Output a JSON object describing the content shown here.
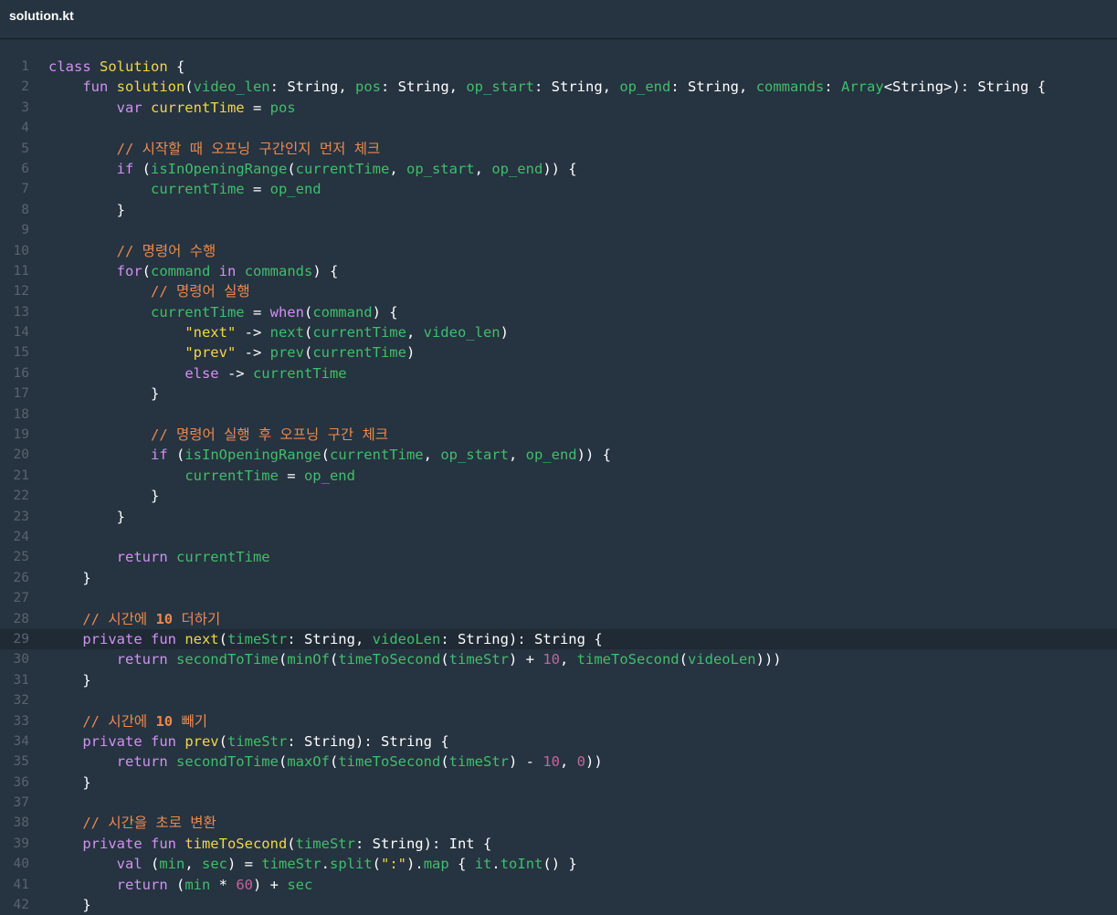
{
  "tab": {
    "filename": "solution.kt"
  },
  "editor": {
    "highlighted_line": 29,
    "lines": [
      [
        [
          "kw",
          "class "
        ],
        [
          "fn",
          "Solution"
        ],
        [
          "p",
          " {"
        ]
      ],
      [
        [
          "p",
          "    "
        ],
        [
          "kw",
          "fun "
        ],
        [
          "fn",
          "solution"
        ],
        [
          "p",
          "("
        ],
        [
          "id",
          "video_len"
        ],
        [
          "p",
          ": "
        ],
        [
          "tp",
          "String"
        ],
        [
          "p",
          ", "
        ],
        [
          "id",
          "pos"
        ],
        [
          "p",
          ": "
        ],
        [
          "tp",
          "String"
        ],
        [
          "p",
          ", "
        ],
        [
          "id",
          "op_start"
        ],
        [
          "p",
          ": "
        ],
        [
          "tp",
          "String"
        ],
        [
          "p",
          ", "
        ],
        [
          "id",
          "op_end"
        ],
        [
          "p",
          ": "
        ],
        [
          "tp",
          "String"
        ],
        [
          "p",
          ", "
        ],
        [
          "id",
          "commands"
        ],
        [
          "p",
          ": "
        ],
        [
          "id",
          "Array"
        ],
        [
          "p",
          "<"
        ],
        [
          "tp",
          "String"
        ],
        [
          "p",
          ">): "
        ],
        [
          "tp",
          "String"
        ],
        [
          "p",
          " {"
        ]
      ],
      [
        [
          "p",
          "        "
        ],
        [
          "kw",
          "var "
        ],
        [
          "fn",
          "currentTime"
        ],
        [
          "p",
          " = "
        ],
        [
          "id",
          "pos"
        ]
      ],
      [],
      [
        [
          "p",
          "        "
        ],
        [
          "cm",
          "// 시작할 때 오프닝 구간인지 먼저 체크"
        ]
      ],
      [
        [
          "p",
          "        "
        ],
        [
          "kw",
          "if "
        ],
        [
          "p",
          "("
        ],
        [
          "id",
          "isInOpeningRange"
        ],
        [
          "p",
          "("
        ],
        [
          "id",
          "currentTime"
        ],
        [
          "p",
          ", "
        ],
        [
          "id",
          "op_start"
        ],
        [
          "p",
          ", "
        ],
        [
          "id",
          "op_end"
        ],
        [
          "p",
          ")) {"
        ]
      ],
      [
        [
          "p",
          "            "
        ],
        [
          "id",
          "currentTime"
        ],
        [
          "p",
          " = "
        ],
        [
          "id",
          "op_end"
        ]
      ],
      [
        [
          "p",
          "        }"
        ]
      ],
      [],
      [
        [
          "p",
          "        "
        ],
        [
          "cm",
          "// 명령어 수행"
        ]
      ],
      [
        [
          "p",
          "        "
        ],
        [
          "kw",
          "for"
        ],
        [
          "p",
          "("
        ],
        [
          "id",
          "command"
        ],
        [
          "p",
          " "
        ],
        [
          "kw",
          "in"
        ],
        [
          "p",
          " "
        ],
        [
          "id",
          "commands"
        ],
        [
          "p",
          ") {"
        ]
      ],
      [
        [
          "p",
          "            "
        ],
        [
          "cm",
          "// 명령어 실행"
        ]
      ],
      [
        [
          "p",
          "            "
        ],
        [
          "id",
          "currentTime"
        ],
        [
          "p",
          " = "
        ],
        [
          "kw",
          "when"
        ],
        [
          "p",
          "("
        ],
        [
          "id",
          "command"
        ],
        [
          "p",
          ") {"
        ]
      ],
      [
        [
          "p",
          "                "
        ],
        [
          "str",
          "\"next\""
        ],
        [
          "p",
          " -> "
        ],
        [
          "id",
          "next"
        ],
        [
          "p",
          "("
        ],
        [
          "id",
          "currentTime"
        ],
        [
          "p",
          ", "
        ],
        [
          "id",
          "video_len"
        ],
        [
          "p",
          ")"
        ]
      ],
      [
        [
          "p",
          "                "
        ],
        [
          "str",
          "\"prev\""
        ],
        [
          "p",
          " -> "
        ],
        [
          "id",
          "prev"
        ],
        [
          "p",
          "("
        ],
        [
          "id",
          "currentTime"
        ],
        [
          "p",
          ")"
        ]
      ],
      [
        [
          "p",
          "                "
        ],
        [
          "kw",
          "else"
        ],
        [
          "p",
          " -> "
        ],
        [
          "id",
          "currentTime"
        ]
      ],
      [
        [
          "p",
          "            }"
        ]
      ],
      [],
      [
        [
          "p",
          "            "
        ],
        [
          "cm",
          "// 명령어 실행 후 오프닝 구간 체크"
        ]
      ],
      [
        [
          "p",
          "            "
        ],
        [
          "kw",
          "if "
        ],
        [
          "p",
          "("
        ],
        [
          "id",
          "isInOpeningRange"
        ],
        [
          "p",
          "("
        ],
        [
          "id",
          "currentTime"
        ],
        [
          "p",
          ", "
        ],
        [
          "id",
          "op_start"
        ],
        [
          "p",
          ", "
        ],
        [
          "id",
          "op_end"
        ],
        [
          "p",
          ")) {"
        ]
      ],
      [
        [
          "p",
          "                "
        ],
        [
          "id",
          "currentTime"
        ],
        [
          "p",
          " = "
        ],
        [
          "id",
          "op_end"
        ]
      ],
      [
        [
          "p",
          "            }"
        ]
      ],
      [
        [
          "p",
          "        }"
        ]
      ],
      [],
      [
        [
          "p",
          "        "
        ],
        [
          "kw",
          "return "
        ],
        [
          "id",
          "currentTime"
        ]
      ],
      [
        [
          "p",
          "    }"
        ]
      ],
      [],
      [
        [
          "p",
          "    "
        ],
        [
          "cm",
          "// 시간에 "
        ],
        [
          "num2",
          "10"
        ],
        [
          "cm",
          " 더하기"
        ]
      ],
      [
        [
          "p",
          "    "
        ],
        [
          "kw",
          "private fun "
        ],
        [
          "fn",
          "next"
        ],
        [
          "p",
          "("
        ],
        [
          "id",
          "timeStr"
        ],
        [
          "p",
          ": "
        ],
        [
          "tp",
          "String"
        ],
        [
          "p",
          ", "
        ],
        [
          "id",
          "videoLen"
        ],
        [
          "p",
          ": "
        ],
        [
          "tp",
          "String"
        ],
        [
          "p",
          "): "
        ],
        [
          "tp",
          "String"
        ],
        [
          "p",
          " {"
        ]
      ],
      [
        [
          "p",
          "        "
        ],
        [
          "kw",
          "return "
        ],
        [
          "id",
          "secondToTime"
        ],
        [
          "p",
          "("
        ],
        [
          "id",
          "minOf"
        ],
        [
          "p",
          "("
        ],
        [
          "id",
          "timeToSecond"
        ],
        [
          "p",
          "("
        ],
        [
          "id",
          "timeStr"
        ],
        [
          "p",
          ") + "
        ],
        [
          "num",
          "10"
        ],
        [
          "p",
          ", "
        ],
        [
          "id",
          "timeToSecond"
        ],
        [
          "p",
          "("
        ],
        [
          "id",
          "videoLen"
        ],
        [
          "p",
          ")))"
        ]
      ],
      [
        [
          "p",
          "    }"
        ]
      ],
      [],
      [
        [
          "p",
          "    "
        ],
        [
          "cm",
          "// 시간에 "
        ],
        [
          "num2",
          "10"
        ],
        [
          "cm",
          " 빼기"
        ]
      ],
      [
        [
          "p",
          "    "
        ],
        [
          "kw",
          "private fun "
        ],
        [
          "fn",
          "prev"
        ],
        [
          "p",
          "("
        ],
        [
          "id",
          "timeStr"
        ],
        [
          "p",
          ": "
        ],
        [
          "tp",
          "String"
        ],
        [
          "p",
          "): "
        ],
        [
          "tp",
          "String"
        ],
        [
          "p",
          " {"
        ]
      ],
      [
        [
          "p",
          "        "
        ],
        [
          "kw",
          "return "
        ],
        [
          "id",
          "secondToTime"
        ],
        [
          "p",
          "("
        ],
        [
          "id",
          "maxOf"
        ],
        [
          "p",
          "("
        ],
        [
          "id",
          "timeToSecond"
        ],
        [
          "p",
          "("
        ],
        [
          "id",
          "timeStr"
        ],
        [
          "p",
          ") - "
        ],
        [
          "num",
          "10"
        ],
        [
          "p",
          ", "
        ],
        [
          "num",
          "0"
        ],
        [
          "p",
          "))"
        ]
      ],
      [
        [
          "p",
          "    }"
        ]
      ],
      [],
      [
        [
          "p",
          "    "
        ],
        [
          "cm",
          "// 시간을 초로 변환"
        ]
      ],
      [
        [
          "p",
          "    "
        ],
        [
          "kw",
          "private fun "
        ],
        [
          "fn",
          "timeToSecond"
        ],
        [
          "p",
          "("
        ],
        [
          "id",
          "timeStr"
        ],
        [
          "p",
          ": "
        ],
        [
          "tp",
          "String"
        ],
        [
          "p",
          "): "
        ],
        [
          "tp",
          "Int"
        ],
        [
          "p",
          " {"
        ]
      ],
      [
        [
          "p",
          "        "
        ],
        [
          "kw",
          "val "
        ],
        [
          "p",
          "("
        ],
        [
          "id",
          "min"
        ],
        [
          "p",
          ", "
        ],
        [
          "id",
          "sec"
        ],
        [
          "p",
          ") = "
        ],
        [
          "id",
          "timeStr"
        ],
        [
          "p",
          "."
        ],
        [
          "id",
          "split"
        ],
        [
          "p",
          "("
        ],
        [
          "str",
          "\":\""
        ],
        [
          "p",
          ")."
        ],
        [
          "id",
          "map"
        ],
        [
          "p",
          " { "
        ],
        [
          "id",
          "it"
        ],
        [
          "p",
          "."
        ],
        [
          "id",
          "toInt"
        ],
        [
          "p",
          "() }"
        ]
      ],
      [
        [
          "p",
          "        "
        ],
        [
          "kw",
          "return "
        ],
        [
          "p",
          "("
        ],
        [
          "id",
          "min"
        ],
        [
          "p",
          " * "
        ],
        [
          "num",
          "60"
        ],
        [
          "p",
          ") + "
        ],
        [
          "id",
          "sec"
        ]
      ],
      [
        [
          "p",
          "    }"
        ]
      ]
    ]
  }
}
